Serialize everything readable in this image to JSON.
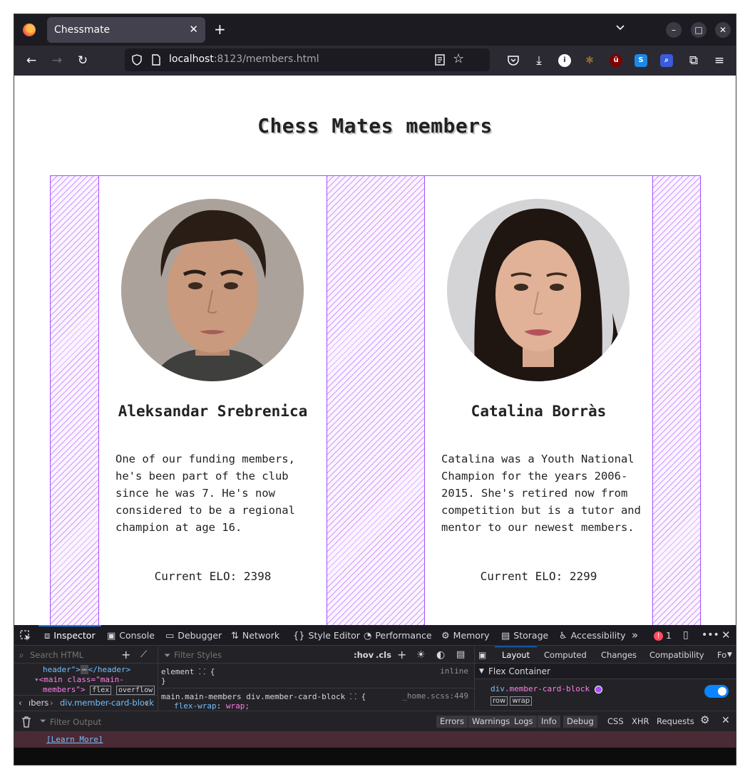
{
  "browser": {
    "tab_title": "Chessmate",
    "tab_close": "✕",
    "new_tab": "+",
    "url_host": "localhost",
    "url_rest": ":8123/members.html"
  },
  "page": {
    "title": "Chess Mates members",
    "members": [
      {
        "name": "Aleksandar Srebrenica",
        "bio": "One of our funding members, he's been part of the club since he was 7. He's now considered to be a regional champion at age 16.",
        "elo": "Current ELO: 2398"
      },
      {
        "name": "Catalina Borràs",
        "bio": "Catalina was a Youth National Champion for the years 2006-2015. She's retired now from competition but is a tutor and mentor to our newest members.",
        "elo": "Current ELO: 2299"
      }
    ]
  },
  "devtools": {
    "tabs": [
      "Inspector",
      "Console",
      "Debugger",
      "Network",
      "Style Editor",
      "Performance",
      "Memory",
      "Storage",
      "Accessibility"
    ],
    "error_count": "1",
    "search_html_placeholder": "Search HTML",
    "markup_line1": "header\">",
    "markup_line1_end": "</header>",
    "markup_line2_tag": "<main class=\"main-",
    "markup_line3": "members\">",
    "badge_flex": "flex",
    "badge_overflow": "overflow",
    "breadcrumb_prev": "ıbers",
    "breadcrumb_current": "div.member-card-block",
    "filter_styles_placeholder": "Filter Styles",
    "hov": ":hov",
    "cls": ".cls",
    "rule1_selector": "element",
    "rule1_source": "inline",
    "rule1_close": "}",
    "rule2_selector": "main.main-members div.member-card-block",
    "rule2_source": "_home.scss:449",
    "rule2_prop": "flex-wrap",
    "rule2_value": "wrap;",
    "layout_tabs": [
      "Layout",
      "Computed",
      "Changes",
      "Compatibility",
      "Fo"
    ],
    "flex_container_label": "Flex Container",
    "flex_selector_tag": "div",
    "flex_selector_class": ".member-card-block",
    "flex_badges": [
      "row",
      "wrap"
    ],
    "filter_output_placeholder": "Filter Output",
    "console_filters": [
      "Errors",
      "Warnings",
      "Logs",
      "Info",
      "Debug"
    ],
    "console_extra": [
      "CSS",
      "XHR",
      "Requests"
    ],
    "learn_more": "[Learn More]"
  },
  "colors": {
    "flex_overlay": "#a64dff",
    "toggle_on": "#0a84ff",
    "error_badge": "#ff4f5e"
  }
}
